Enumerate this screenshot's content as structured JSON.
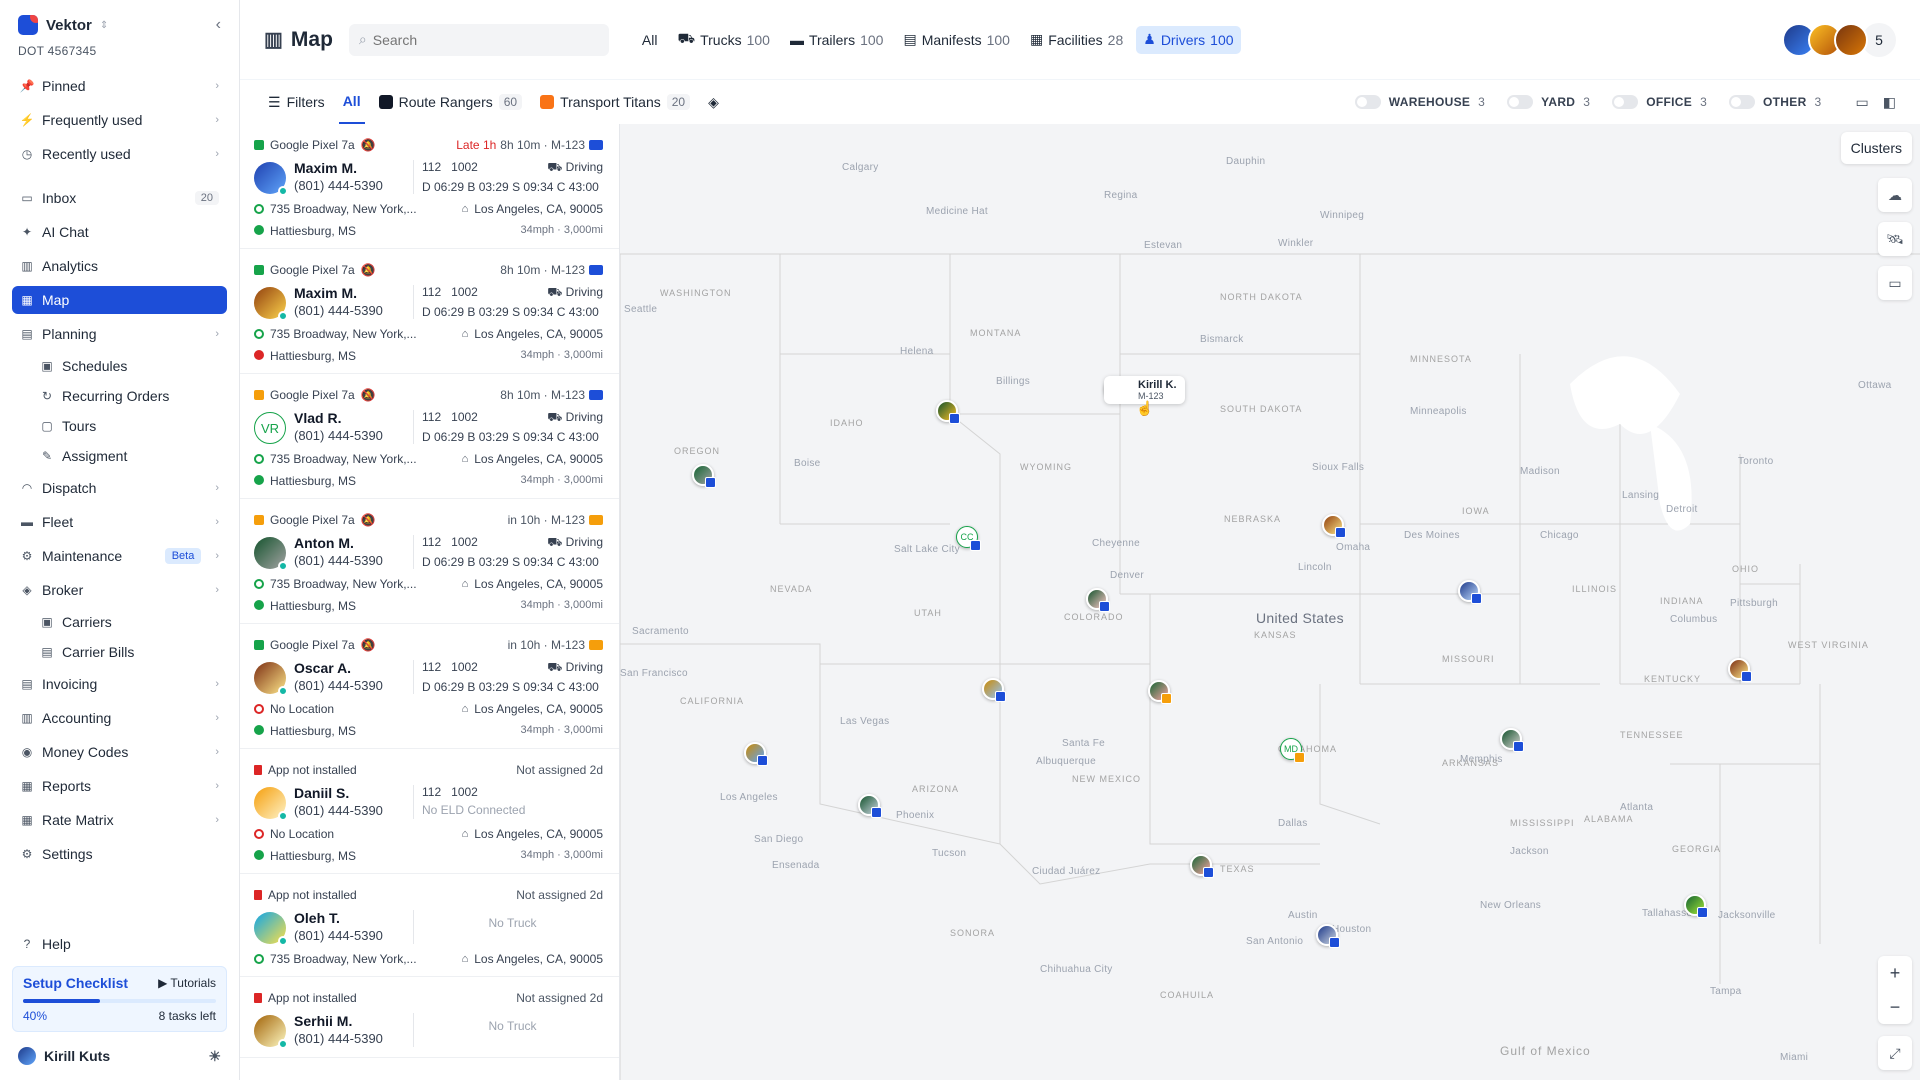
{
  "brand": {
    "name": "Vektor",
    "dot": "DOT 4567345"
  },
  "nav": {
    "pinned": "Pinned",
    "frequent": "Frequently used",
    "recent": "Recently used",
    "inbox": "Inbox",
    "inbox_count": "20",
    "ai_chat": "AI Chat",
    "analytics": "Analytics",
    "map": "Map",
    "planning": "Planning",
    "schedules": "Schedules",
    "recurring": "Recurring Orders",
    "tours": "Tours",
    "assigment": "Assigment",
    "dispatch": "Dispatch",
    "fleet": "Fleet",
    "maintenance": "Maintenance",
    "beta": "Beta",
    "broker": "Broker",
    "carriers": "Carriers",
    "carrier_bills": "Carrier Bills",
    "invoicing": "Invoicing",
    "accounting": "Accounting",
    "money_codes": "Money Codes",
    "reports": "Reports",
    "rate_matrix": "Rate Matrix",
    "settings": "Settings",
    "help": "Help"
  },
  "setup": {
    "title": "Setup Checklist",
    "tutorials": "Tutorials",
    "percent": "40%",
    "progress": 0.4,
    "left": "8 tasks left"
  },
  "user": {
    "name": "Kirill Kuts"
  },
  "header": {
    "title": "Map",
    "search_placeholder": "Search",
    "segments": [
      {
        "label": "All",
        "count": ""
      },
      {
        "label": "Trucks",
        "count": "100"
      },
      {
        "label": "Trailers",
        "count": "100"
      },
      {
        "label": "Manifests",
        "count": "100"
      },
      {
        "label": "Facilities",
        "count": "28"
      },
      {
        "label": "Drivers",
        "count": "100"
      }
    ],
    "team_more": "5"
  },
  "filters": {
    "label": "Filters",
    "all": "All",
    "team1": "Route Rangers",
    "team1_count": "60",
    "team2": "Transport Titans",
    "team2_count": "20",
    "toggles": [
      {
        "label": "WAREHOUSE",
        "count": "3"
      },
      {
        "label": "YARD",
        "count": "3"
      },
      {
        "label": "OFFICE",
        "count": "3"
      },
      {
        "label": "OTHER",
        "count": "3"
      }
    ]
  },
  "drivers": [
    {
      "device": "Google Pixel 7a",
      "status": "Late 1h",
      "eta": "8h 10m · M-123",
      "name": "Maxim M.",
      "phone": "(801) 444-5390",
      "truck": "112",
      "trailer": "1002",
      "state": "Driving",
      "hos": "D 06:29  B 03:29  S 09:34  C 43:00",
      "from": "735 Broadway, New York,...",
      "to": "Los Angeles, CA, 90005",
      "current": "Hattiesburg, MS",
      "speed": "34mph · 3,000mi"
    },
    {
      "device": "Google Pixel 7a",
      "status": "",
      "eta": "8h 10m · M-123",
      "name": "Maxim M.",
      "phone": "(801) 444-5390",
      "truck": "112",
      "trailer": "1002",
      "state": "Driving",
      "hos": "D 06:29  B 03:29  S 09:34  C 43:00",
      "from": "735 Broadway, New York,...",
      "to": "Los Angeles, CA, 90005",
      "current": "Hattiesburg, MS",
      "speed": "34mph · 3,000mi"
    },
    {
      "device": "Google Pixel 7a",
      "status": "",
      "eta": "8h 10m · M-123",
      "name": "Vlad R.",
      "initials": "VR",
      "phone": "(801) 444-5390",
      "truck": "112",
      "trailer": "1002",
      "state": "Driving",
      "hos": "D 06:29  B 03:29  S 09:34  C 43:00",
      "from": "735 Broadway, New York,...",
      "to": "Los Angeles, CA, 90005",
      "current": "Hattiesburg, MS",
      "speed": "34mph · 3,000mi"
    },
    {
      "device": "Google Pixel 7a",
      "status": "",
      "eta": "in 10h · M-123",
      "name": "Anton M.",
      "phone": "(801) 444-5390",
      "truck": "112",
      "trailer": "1002",
      "state": "Driving",
      "hos": "D 06:29  B 03:29  S 09:34  C 43:00",
      "from": "735 Broadway, New York,...",
      "to": "Los Angeles, CA, 90005",
      "current": "Hattiesburg, MS",
      "speed": "34mph · 3,000mi"
    },
    {
      "device": "Google Pixel 7a",
      "status": "",
      "eta": "in 10h · M-123",
      "name": "Oscar A.",
      "phone": "(801) 444-5390",
      "truck": "112",
      "trailer": "1002",
      "state": "Driving",
      "hos": "D 06:29  B 03:29  S 09:34  C 43:00",
      "from": "No Location",
      "to": "Los Angeles, CA, 90005",
      "current": "Hattiesburg, MS",
      "speed": "34mph · 3,000mi"
    },
    {
      "device": "App not installed",
      "status": "",
      "eta": "Not assigned 2d",
      "name": "Daniil S.",
      "phone": "(801) 444-5390",
      "truck": "112",
      "trailer": "1002",
      "state": "",
      "hos": "No ELD Connected",
      "from": "No Location",
      "to": "Los Angeles, CA, 90005",
      "current": "Hattiesburg, MS",
      "speed": "34mph · 3,000mi"
    },
    {
      "device": "App not installed",
      "status": "",
      "eta": "Not assigned 2d",
      "name": "Oleh T.",
      "phone": "(801) 444-5390",
      "no_truck": "No Truck",
      "from": "735 Broadway, New York,...",
      "to": "Los Angeles, CA, 90005"
    },
    {
      "device": "App not installed",
      "status": "",
      "eta": "Not assigned 2d",
      "name": "Serhii M.",
      "phone": "(801) 444-5390",
      "no_truck": "No Truck"
    }
  ],
  "map": {
    "clusters": "Clusters",
    "tooltip_name": "Kirill K.",
    "tooltip_sub": "M-123",
    "country": "United States",
    "cities": [
      "Calgary",
      "Regina",
      "Winnipeg",
      "Medicine Hat",
      "Estevan",
      "Winkler",
      "Dauphin",
      "Seattle",
      "Helena",
      "Billings",
      "Bismarck",
      "Minneapolis",
      "Boise",
      "Omaha",
      "Des Moines",
      "Sioux Falls",
      "Lincoln",
      "Chicago",
      "Madison",
      "Lansing",
      "Detroit",
      "Toronto",
      "Ottawa",
      "Salt Lake City",
      "Cheyenne",
      "Denver",
      "Sacramento",
      "San Francisco",
      "Las Vegas",
      "Los Angeles",
      "San Diego",
      "Phoenix",
      "Tucson",
      "Ensenada",
      "Santa Fe",
      "Albuquerque",
      "Ciudad Juárez",
      "Dallas",
      "Austin",
      "Houston",
      "San Antonio",
      "Memphis",
      "Atlanta",
      "Jackson",
      "New Orleans",
      "Tallahassee",
      "Jacksonville",
      "Tampa",
      "Miami",
      "Pittsburgh",
      "Columbus",
      "Chihuahua City"
    ],
    "states": [
      "WASHINGTON",
      "MONTANA",
      "NORTH DAKOTA",
      "MINNESOTA",
      "OREGON",
      "IDAHO",
      "SOUTH DAKOTA",
      "WYOMING",
      "NEBRASKA",
      "IOWA",
      "NEVADA",
      "UTAH",
      "COLORADO",
      "KANSAS",
      "ILLINOIS",
      "INDIANA",
      "OHIO",
      "CALIFORNIA",
      "MISSOURI",
      "WEST VIRGINIA",
      "KENTUCKY",
      "ARIZONA",
      "NEW MEXICO",
      "OKLAHOMA",
      "ARKANSAS",
      "TENNESSEE",
      "TEXAS",
      "MISSISSIPPI",
      "ALABAMA",
      "GEORGIA",
      "SONORA",
      "COAHUILA",
      "Gulf of Mexico"
    ],
    "marker_labels": [
      "CC",
      "MD"
    ]
  },
  "colors": {
    "accent": "#1d4ed8",
    "late": "#dc2626",
    "online": "#16a34a"
  }
}
